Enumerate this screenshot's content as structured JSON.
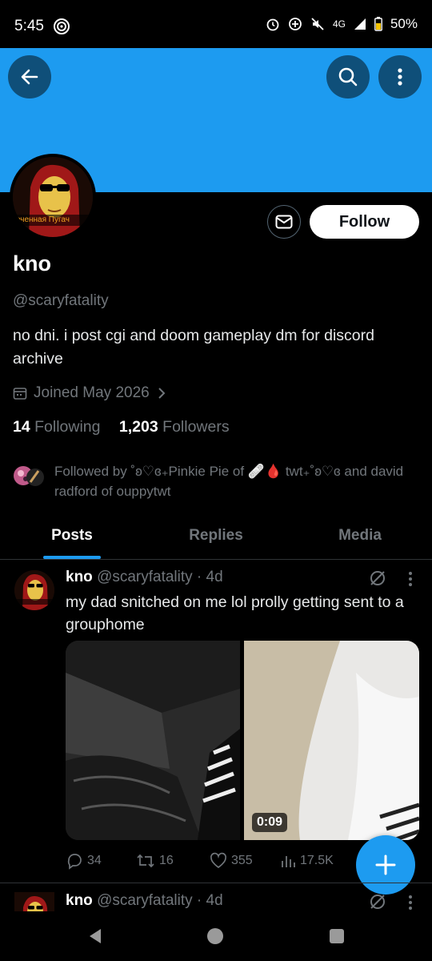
{
  "status_bar": {
    "time": "5:45",
    "network": "4G",
    "battery": "50%"
  },
  "banner": {
    "color": "#1d9bf0"
  },
  "profile": {
    "avatar_caption": "еченная Пугач",
    "name": "kno",
    "handle": "@scaryfatality",
    "bio": "no dni. i post cgi and doom gameplay  dm for discord archive",
    "joined": "Joined May 2026",
    "following_count": "14",
    "following_label": "Following",
    "followers_count": "1,203",
    "followers_label": "Followers",
    "followed_by": "Followed by ˚ʚ♡ɞ₊Pinkie Pie of 🩹🩸 twt₊˚ʚ♡ɞ and david radford of ouppytwt",
    "follow_label": "Follow"
  },
  "tabs": [
    {
      "label": "Posts",
      "active": true
    },
    {
      "label": "Replies",
      "active": false
    },
    {
      "label": "Media",
      "active": false
    }
  ],
  "post": {
    "author": "kno",
    "handle_time": "@scaryfatality · 4d",
    "text": "my dad snitched on me lol prolly getting sent to a grouphome",
    "video_duration": "0:09",
    "replies": "34",
    "reposts": "16",
    "likes": "355",
    "views": "17.5K"
  },
  "next_post": {
    "author": "kno",
    "handle_time": "@scaryfatality · 4d"
  },
  "icons": [
    "back-arrow-icon",
    "search-icon",
    "more-vertical-icon",
    "mail-icon",
    "calendar-icon",
    "reply-icon",
    "repost-icon",
    "heart-icon",
    "views-icon",
    "grok-icon",
    "plus-icon"
  ]
}
